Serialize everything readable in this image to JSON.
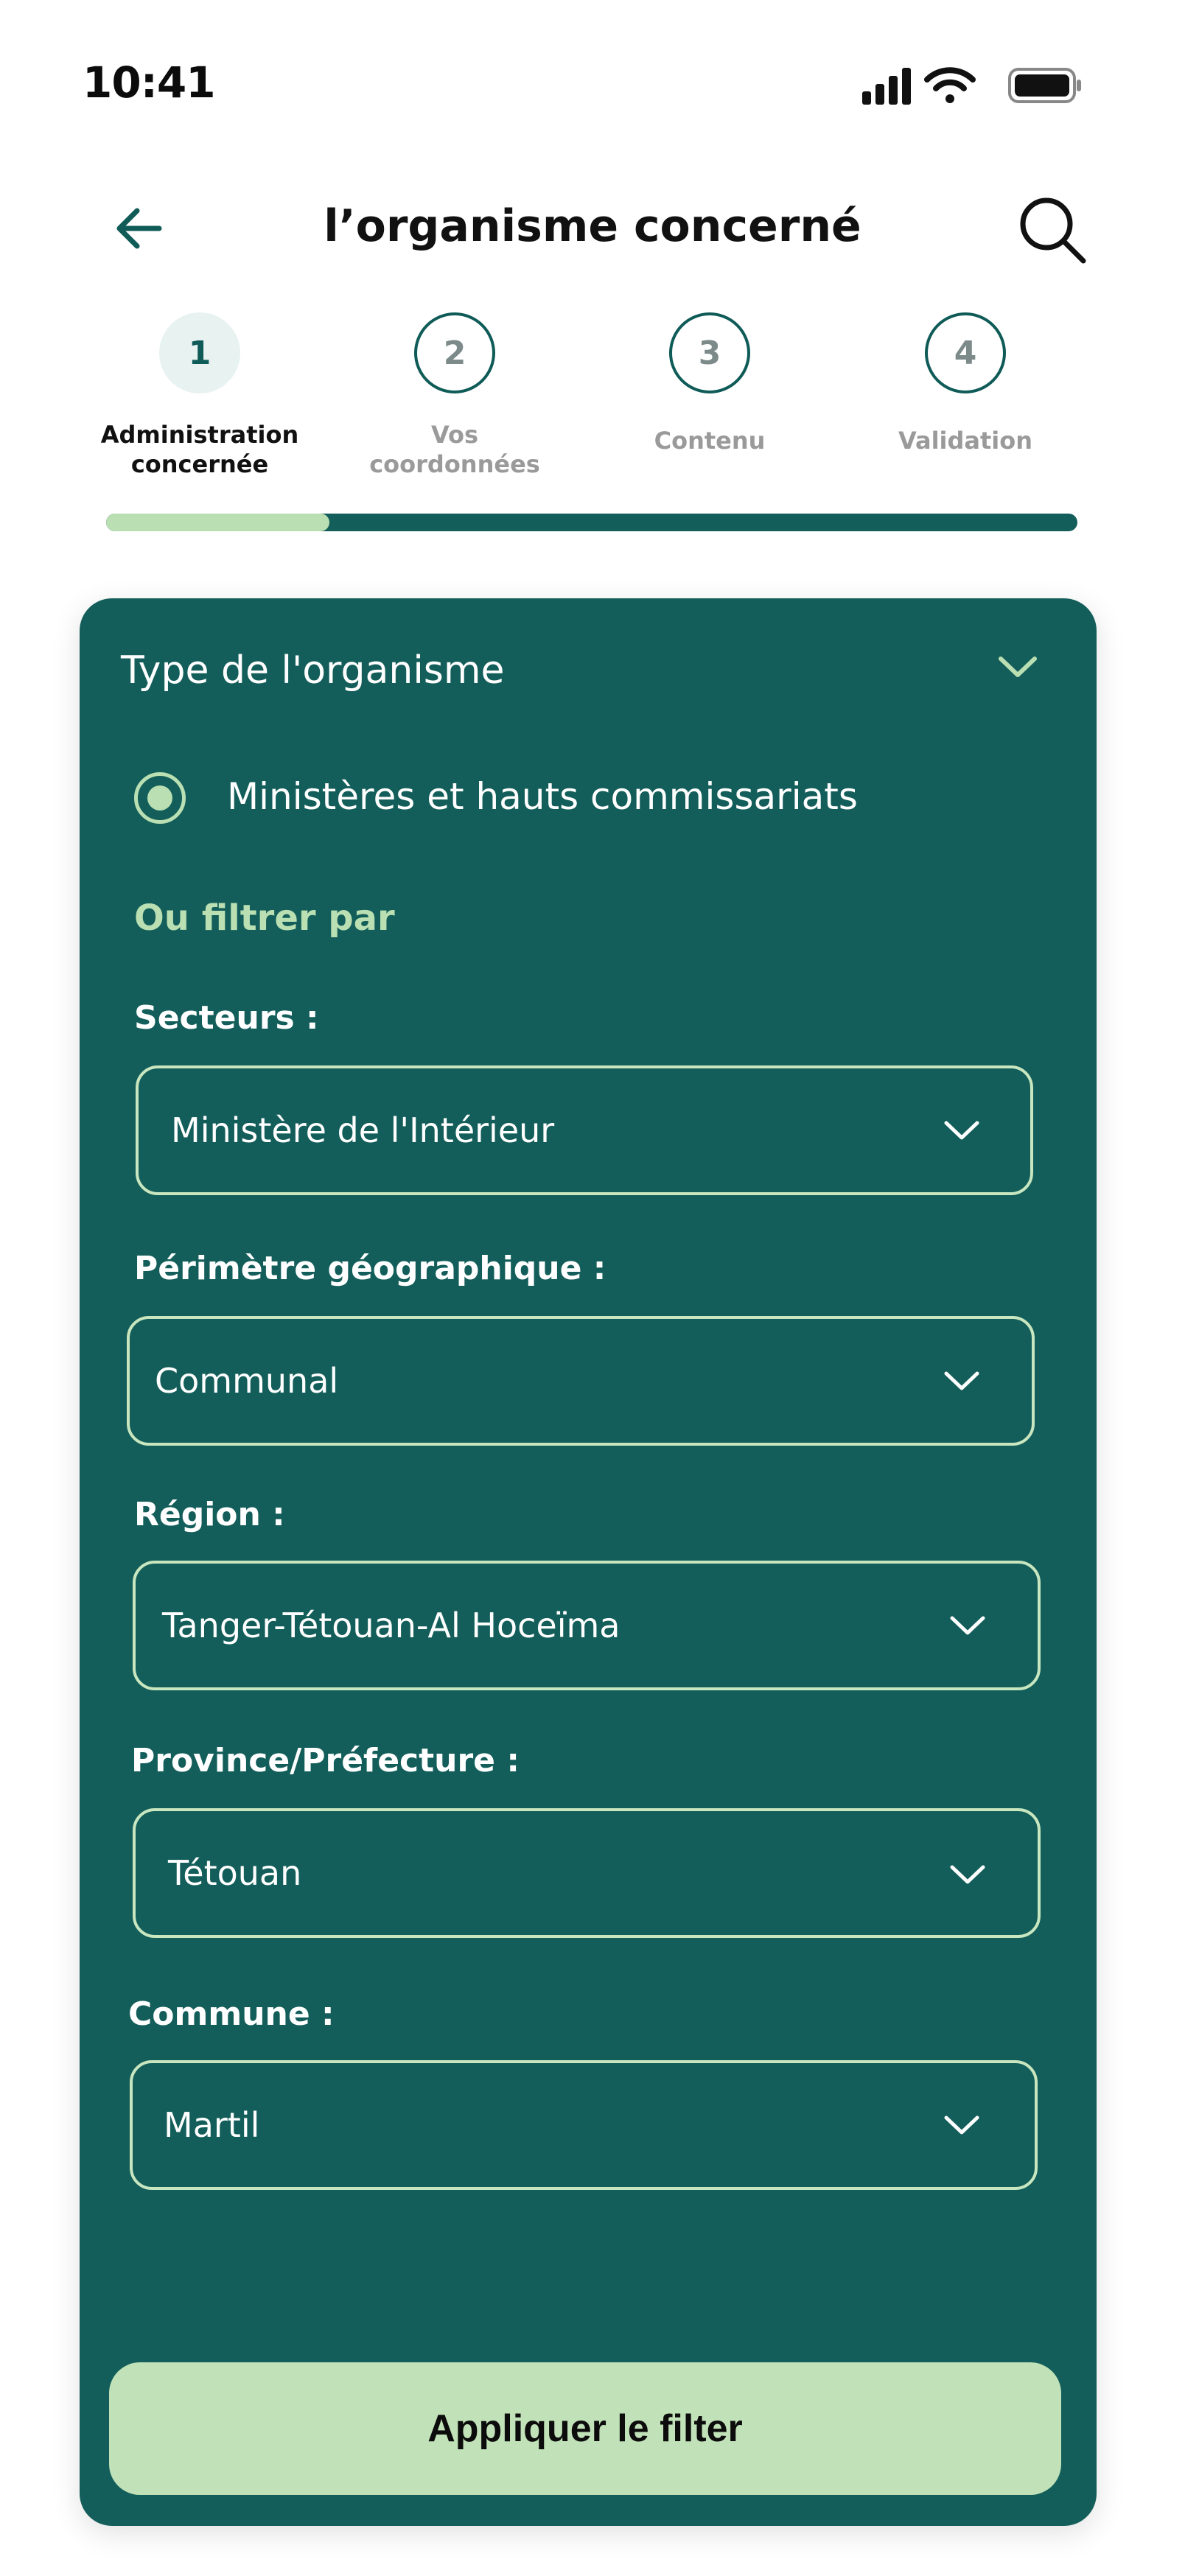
{
  "status_bar": {
    "time": "10:41"
  },
  "header": {
    "title": "l’organisme concerné"
  },
  "stepper": {
    "progress": 0.23,
    "steps": [
      {
        "number": "1",
        "label_line1": "Administration",
        "label_line2": "concernée"
      },
      {
        "number": "2",
        "label_line1": "Vos",
        "label_line2": "coordonnées"
      },
      {
        "number": "3",
        "label_line1": "Contenu",
        "label_line2": ""
      },
      {
        "number": "4",
        "label_line1": "Validation",
        "label_line2": ""
      }
    ]
  },
  "card": {
    "title": "Type de l'organisme",
    "radio_option": "Ministères et hauts commissariats",
    "filter_title": "Ou filtrer par",
    "fields": {
      "secteurs": {
        "label": "Secteurs :",
        "value": "Ministère de l'Intérieur"
      },
      "perimetre": {
        "label": "Périmètre géographique :",
        "value": "Communal"
      },
      "region": {
        "label": "Région :",
        "value": "Tanger-Tétouan-Al Hoceïma"
      },
      "province": {
        "label": "Province/Préfecture :",
        "value": "Tétouan"
      },
      "commune": {
        "label": "Commune :",
        "value": "Martil"
      }
    },
    "apply_label": "Appliquer le filter"
  },
  "colors": {
    "primary": "#135e5a",
    "accent": "#b9dfb2",
    "button": "#c1e2b8"
  },
  "icons": [
    "signal-icon",
    "wifi-icon",
    "battery-icon",
    "back-arrow-icon",
    "search-icon",
    "chevron-down-icon"
  ]
}
